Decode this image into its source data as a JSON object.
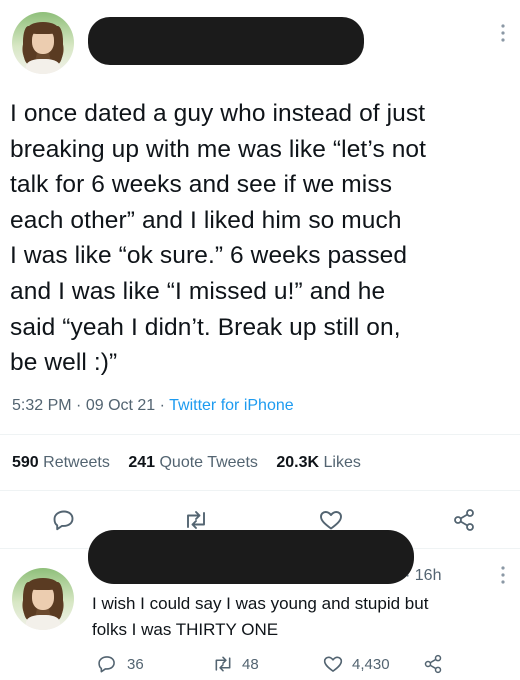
{
  "main_tweet": {
    "text": "I once dated a guy who instead of just\nbreaking up with me was like “let’s not\ntalk for 6 weeks and see if we miss\neach other” and I liked him so much\nI was like “ok sure.” 6 weeks passed\nand I was like “I missed u!” and he\nsaid “yeah I didn’t. Break up still on,\nbe well :)”",
    "time": "5:32 PM",
    "separator": "·",
    "date": "09 Oct 21",
    "source": "Twitter for iPhone",
    "retweets_count": "590",
    "retweets_label": "Retweets",
    "quotes_count": "241",
    "quotes_label": "Quote Tweets",
    "likes_count": "20.3K",
    "likes_label": "Likes"
  },
  "reply_tweet": {
    "time_ago": "· 16h",
    "text": "I wish I could say I was young and stupid but\nfolks I was THIRTY ONE",
    "reply_count": "36",
    "retweet_count": "48",
    "like_count": "4,430"
  },
  "icons": {
    "avatar": "profile-photo",
    "more": "more-vertical-icon",
    "reply": "reply-bubble-icon",
    "retweet": "retweet-arrows-icon",
    "like": "heart-icon",
    "share": "share-nodes-icon"
  },
  "colors": {
    "text": "#0f1419",
    "secondary": "#536471",
    "link": "#1d9bf0",
    "redaction": "#1b1b1b"
  }
}
